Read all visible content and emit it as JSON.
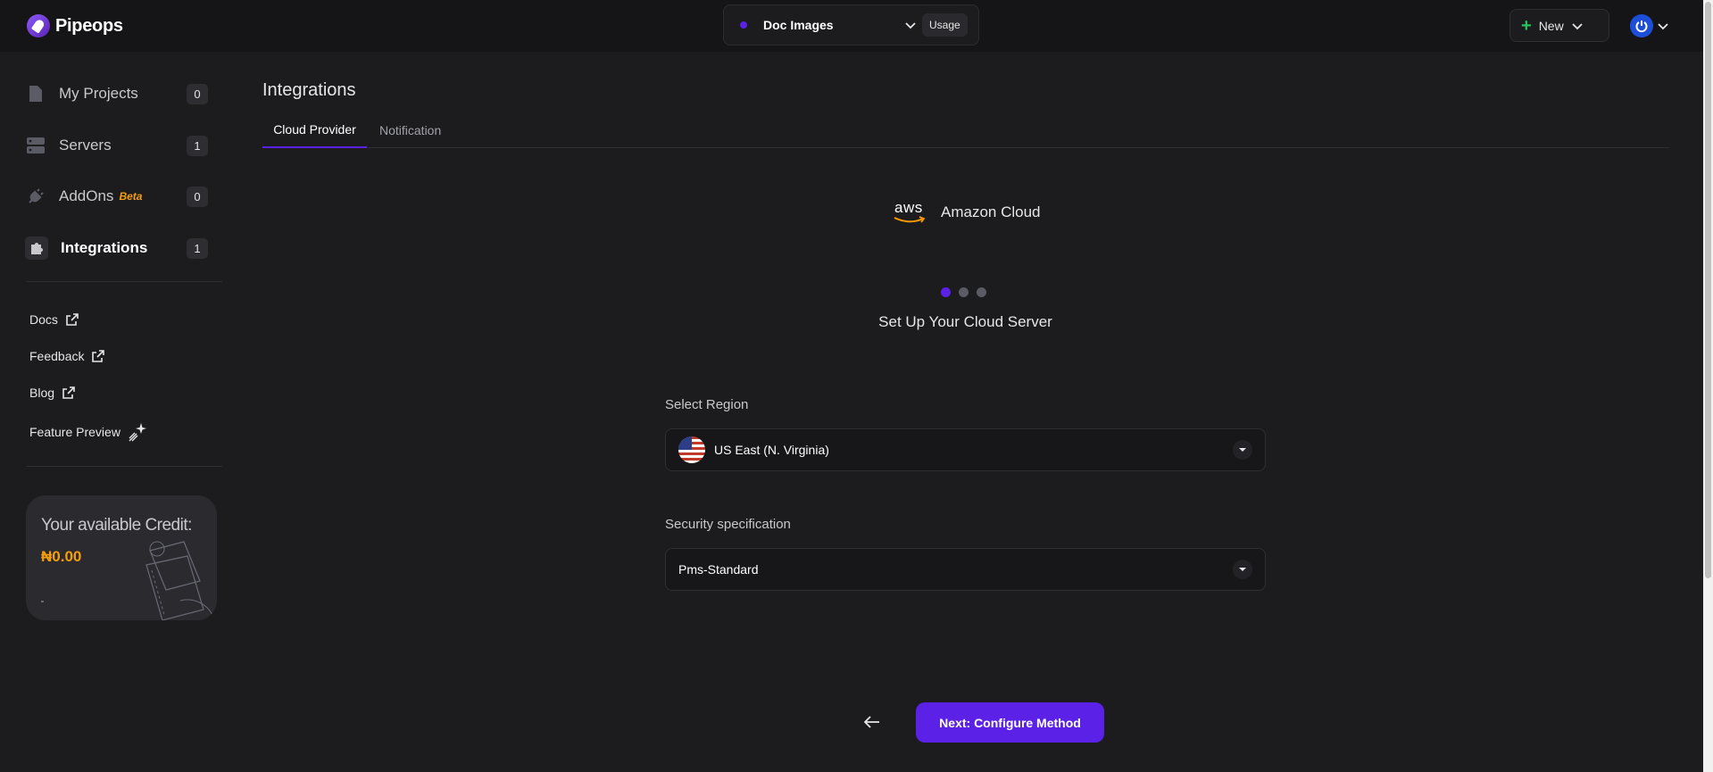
{
  "app": {
    "name": "Pipeops"
  },
  "header": {
    "project_name": "Doc Images",
    "usage_label": "Usage",
    "new_label": "New"
  },
  "sidebar": {
    "items": [
      {
        "label": "My Projects",
        "count": "0",
        "icon": "file-icon"
      },
      {
        "label": "Servers",
        "count": "1",
        "icon": "server-icon"
      },
      {
        "label": "AddOns",
        "badge": "Beta",
        "count": "0",
        "icon": "plug-icon"
      },
      {
        "label": "Integrations",
        "count": "1",
        "icon": "puzzle-icon",
        "active": true
      }
    ],
    "links": [
      {
        "label": "Docs",
        "icon": "external-link-icon"
      },
      {
        "label": "Feedback",
        "icon": "external-link-icon"
      },
      {
        "label": "Blog",
        "icon": "external-link-icon"
      },
      {
        "label": "Feature Preview",
        "icon": "sparkle-icon"
      }
    ],
    "credit": {
      "title": "Your available Credit:",
      "amount": "₦0.00"
    }
  },
  "main": {
    "title": "Integrations",
    "tabs": [
      {
        "label": "Cloud Provider",
        "active": true
      },
      {
        "label": "Notification",
        "active": false
      }
    ],
    "provider": {
      "logo_text": "aws",
      "name": "Amazon Cloud"
    },
    "steps": {
      "total": 3,
      "current": 1
    },
    "step_title": "Set Up Your Cloud Server",
    "region": {
      "label": "Select Region",
      "value": "US East (N. Virginia)"
    },
    "security": {
      "label": "Security specification",
      "value": "Pms-Standard"
    },
    "next_label": "Next: Configure Method"
  },
  "colors": {
    "accent": "#5b21e6",
    "credit": "#f59e0b",
    "background": "#1c1c1f"
  }
}
